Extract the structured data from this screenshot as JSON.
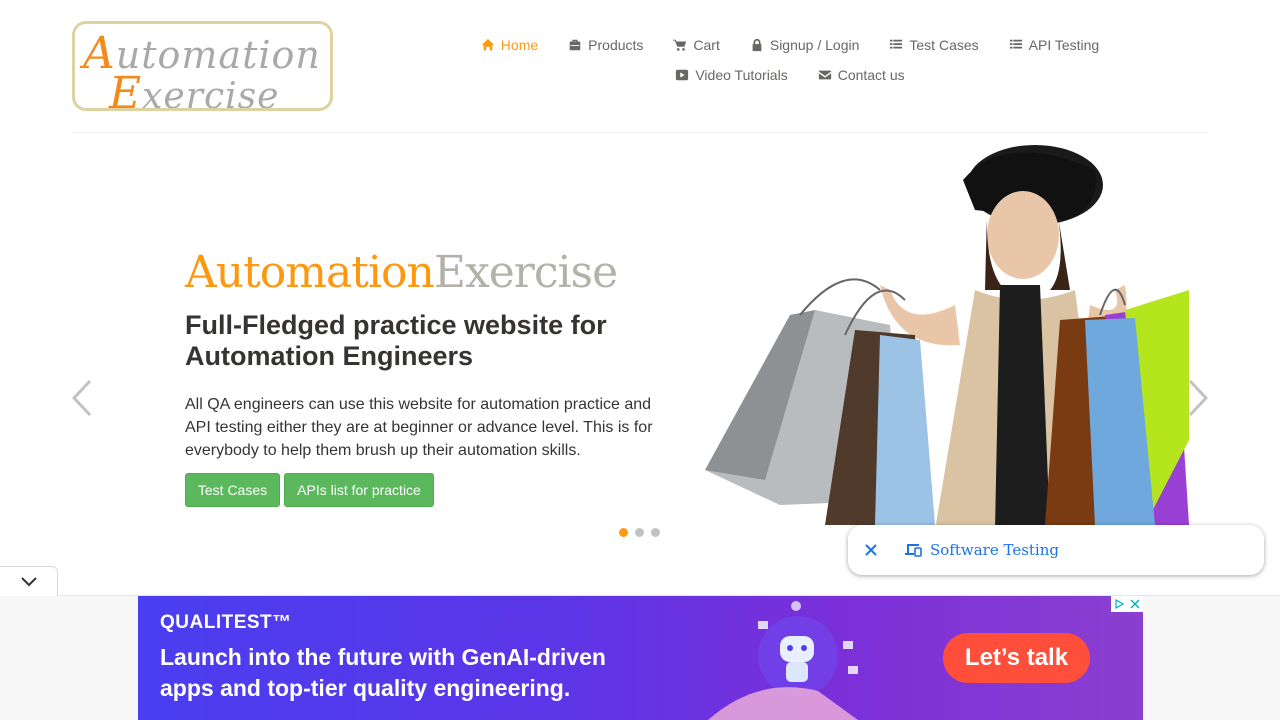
{
  "logo": {
    "line1_cap": "A",
    "line1_rest": "utomation",
    "line2_cap": "E",
    "line2_rest": "xercise"
  },
  "nav": {
    "row1": [
      {
        "label": "Home",
        "icon": "home-icon",
        "active": true
      },
      {
        "label": "Products",
        "icon": "briefcase-icon"
      },
      {
        "label": "Cart",
        "icon": "cart-icon"
      },
      {
        "label": "Signup / Login",
        "icon": "lock-icon"
      },
      {
        "label": "Test Cases",
        "icon": "list-icon"
      },
      {
        "label": "API Testing",
        "icon": "list-icon"
      }
    ],
    "row2": [
      {
        "label": "Video Tutorials",
        "icon": "youtube-icon"
      },
      {
        "label": "Contact us",
        "icon": "envelope-icon"
      }
    ]
  },
  "slider": {
    "title_part1": "Automation",
    "title_part2": "Exercise",
    "subtitle": "Full-Fledged practice website for Automation Engineers",
    "description": "All QA engineers can use this website for automation practice and API testing either they are at beginner or advance level. This is for everybody to help them brush up their automation skills.",
    "button1": "Test Cases",
    "button2": "APIs list for practice",
    "active_slide": 1,
    "slide_count": 3
  },
  "chip": {
    "text": "Software Testing"
  },
  "ad": {
    "brand": "QUALITEST™",
    "line1": "Launch into the future with GenAI-driven",
    "line2": "apps and top-tier quality engineering.",
    "cta": "Let’s talk"
  },
  "colors": {
    "accent": "#fe980f",
    "button": "#5cb85c",
    "link": "#1a73e8",
    "ad_cta": "#ff4f3a"
  }
}
